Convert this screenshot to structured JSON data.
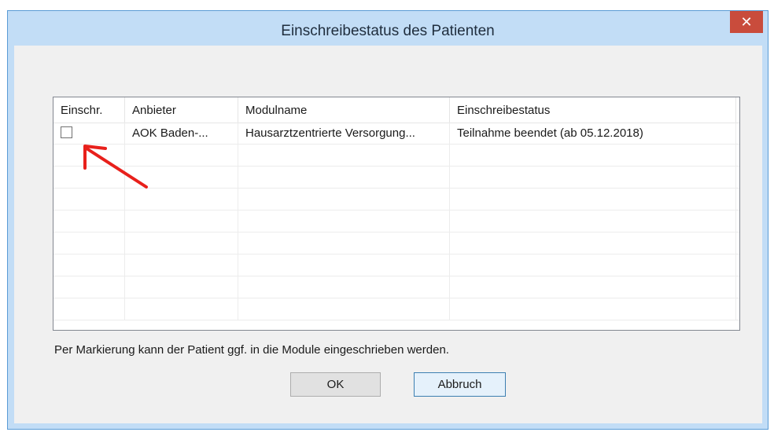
{
  "window": {
    "title": "Einschreibestatus des Patienten",
    "close_label": "✕"
  },
  "grid": {
    "columns": [
      "Einschr.",
      "Anbieter",
      "Modulname",
      "Einschreibestatus"
    ],
    "rows": [
      {
        "checked": false,
        "provider": "AOK Baden-...",
        "module": "Hausarztzentrierte Versorgung...",
        "status": "Teilnahme beendet (ab 05.12.2018)"
      }
    ]
  },
  "hint": "Per Markierung kann der Patient ggf. in die Module eingeschrieben werden.",
  "buttons": {
    "ok": "OK",
    "cancel": "Abbruch"
  },
  "annotation": {
    "arrow_color": "#e8201b"
  }
}
